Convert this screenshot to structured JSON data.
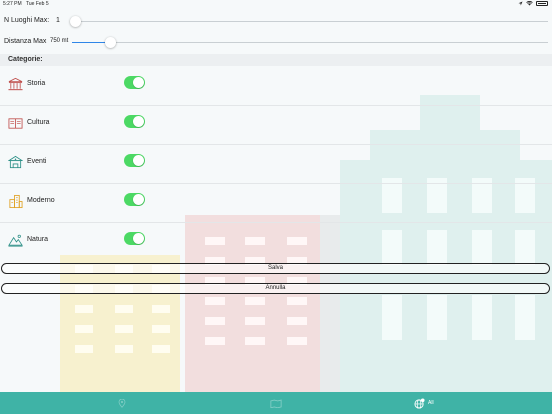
{
  "status_bar": {
    "time": "5:27 PM",
    "date": "Tue Feb 5"
  },
  "settings": {
    "luoghi": {
      "label": "N Luoghi Max:",
      "value": "1",
      "level": 0.0
    },
    "distanza": {
      "label": "Distanza Max",
      "value": "750 mt",
      "level": 0.07
    }
  },
  "categories": {
    "header": "Categorie:",
    "items": [
      {
        "name": "storia",
        "label": "Storia",
        "icon": "columns-building-icon",
        "enabled": true
      },
      {
        "name": "cultura",
        "label": "Cultura",
        "icon": "open-book-icon",
        "enabled": true
      },
      {
        "name": "eventi",
        "label": "Eventi",
        "icon": "pavilion-icon",
        "enabled": true
      },
      {
        "name": "moderno",
        "label": "Moderno",
        "icon": "skyscraper-icon",
        "enabled": true
      },
      {
        "name": "natura",
        "label": "Natura",
        "icon": "mountain-icon",
        "enabled": true
      }
    ]
  },
  "buttons": {
    "save": "Salva",
    "cancel": "Annulla"
  },
  "tabbar": {
    "tabs": [
      {
        "label": "",
        "icon": "map-pin-icon"
      },
      {
        "label": "",
        "icon": "map-icon"
      },
      {
        "label": "All",
        "icon": "globe-settings-icon",
        "active": true
      }
    ]
  },
  "colors": {
    "toggle_on": "#4cd964",
    "slider_fill": "#2f86e8",
    "tabbar": "#3fb3a6"
  }
}
